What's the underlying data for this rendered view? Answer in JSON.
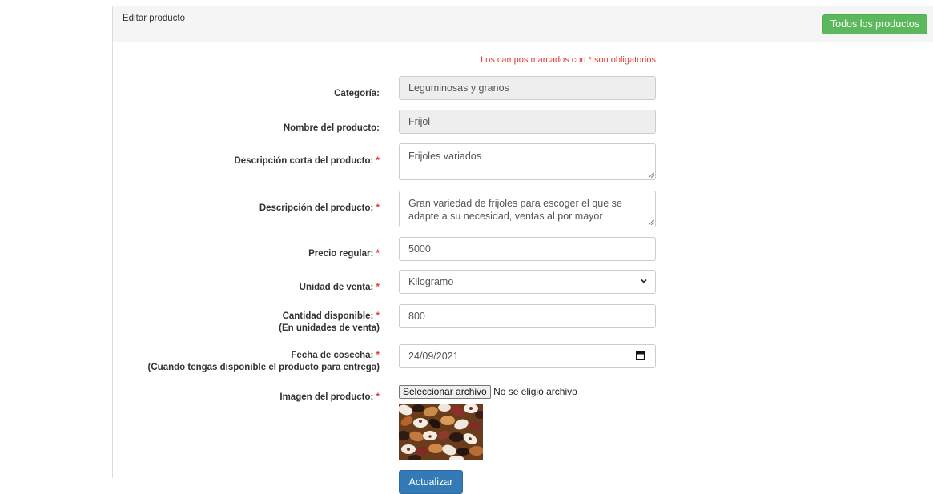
{
  "header": {
    "title": "Editar producto",
    "all_products_button": "Todos los productos"
  },
  "form": {
    "required_note": "Los campos marcados con * son obligatorios",
    "category": {
      "label": "Categoría:",
      "value": "Leguminosas y granos"
    },
    "product_name": {
      "label": "Nombre del producto:",
      "value": "Frijol"
    },
    "short_description": {
      "label": "Descripción corta del producto:",
      "star": "*",
      "value": "Frijoles variados"
    },
    "description": {
      "label": "Descripción del producto:",
      "star": "*",
      "value": "Gran variedad de frijoles para escoger el que se adapte a su necesidad, ventas al por mayor"
    },
    "regular_price": {
      "label": "Precio regular:",
      "star": "*",
      "value": "5000"
    },
    "sale_unit": {
      "label": "Unidad de venta:",
      "star": "*",
      "value": "Kilogramo"
    },
    "available_quantity": {
      "label": "Cantidad disponible:",
      "star": "*",
      "sublabel": "(En unidades de venta)",
      "value": "800"
    },
    "harvest_date": {
      "label": "Fecha de cosecha:",
      "star": "*",
      "sublabel": "(Cuando tengas disponible el producto para entrega)",
      "value": "24/09/2021"
    },
    "product_image": {
      "label": "Imagen del producto:",
      "star": "*",
      "file_button": "Seleccionar archivo",
      "file_status": "No se eligió archivo"
    },
    "update_button": "Actualizar"
  },
  "colors": {
    "green": "#5cb85c",
    "blue": "#337ab7",
    "required_red": "#e53935"
  },
  "icons": {
    "select": "chevron-down-icon",
    "date": "calendar-icon",
    "resize": "resize-grip-icon"
  }
}
